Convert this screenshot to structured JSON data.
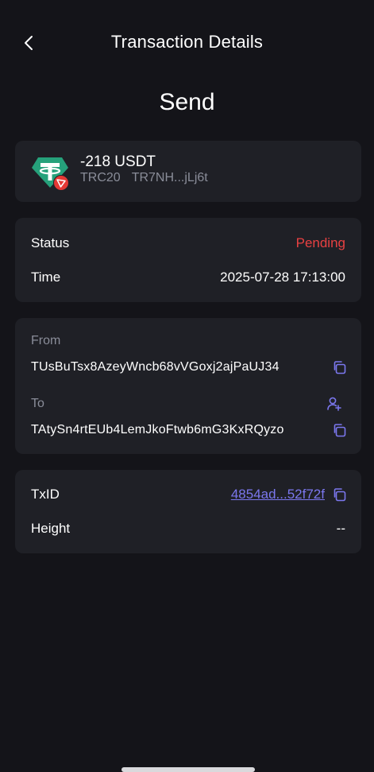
{
  "header": {
    "title": "Transaction Details",
    "back_icon": "chevron-left-icon"
  },
  "type_label": "Send",
  "asset": {
    "amount": "-218 USDT",
    "network": "TRC20",
    "short_address": "TR7NH...jLj6t",
    "token_icon": "tether-icon",
    "network_badge_icon": "tron-icon",
    "colors": {
      "token": "#26a17b",
      "badge": "#e53935"
    }
  },
  "status_card": {
    "status_label": "Status",
    "status_value": "Pending",
    "time_label": "Time",
    "time_value": "2025-07-28 17:13:00",
    "status_color": "#e84142"
  },
  "addresses": {
    "from_label": "From",
    "from_value": "TUsBuTsx8AzeyWncb68vVGoxj2ajPaUJ34",
    "to_label": "To",
    "to_value": "TAtySn4rtEUb4LemJkoFtwb6mG3KxRQyzo",
    "copy_icon": "copy-icon",
    "add_contact_icon": "add-contact-icon"
  },
  "tx_card": {
    "txid_label": "TxID",
    "txid_value": "4854ad...52f72f",
    "height_label": "Height",
    "height_value": "--",
    "link_color": "#7b77ee"
  }
}
